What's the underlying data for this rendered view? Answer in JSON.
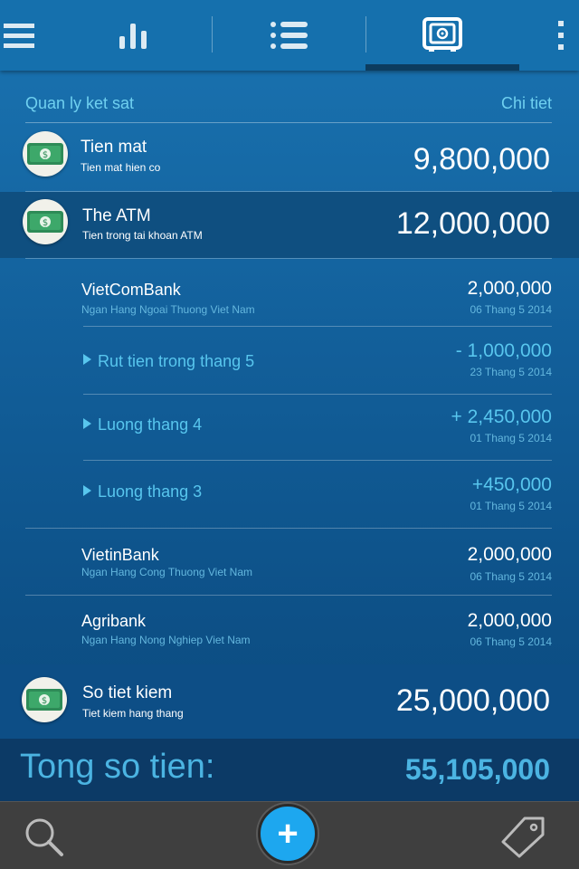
{
  "toolbar": {
    "icons": [
      "menu-icon",
      "chart-icon",
      "list-icon",
      "safe-icon",
      "more-icon"
    ],
    "active": "safe-icon"
  },
  "header": {
    "title": "Quan ly ket sat",
    "detail_link": "Chi tiet"
  },
  "accounts": {
    "cash": {
      "name": "Tien mat",
      "desc": "Tien mat hien co",
      "amount": "9,800,000"
    },
    "atm": {
      "name": "The ATM",
      "desc": "Tien trong tai khoan ATM",
      "amount": "12,000,000"
    },
    "savings": {
      "name": "So tiet kiem",
      "desc": "Tiet kiem hang thang",
      "amount": "25,000,000"
    }
  },
  "banks": [
    {
      "name": "VietComBank",
      "desc": "Ngan Hang Ngoai Thuong Viet Nam",
      "amount": "2,000,000",
      "date": "06 Thang 5 2014"
    },
    {
      "name": "VietinBank",
      "desc": "Ngan Hang Cong Thuong Viet Nam",
      "amount": "2,000,000",
      "date": "06 Thang 5 2014"
    },
    {
      "name": "Agribank",
      "desc": "Ngan Hang Nong Nghiep Viet Nam",
      "amount": "2,000,000",
      "date": "06 Thang 5 2014"
    }
  ],
  "transactions": [
    {
      "label": "Rut tien trong thang 5",
      "amount": "- 1,000,000",
      "date": "23 Thang 5 2014"
    },
    {
      "label": "Luong thang 4",
      "amount": "+ 2,450,000",
      "date": "01 Thang 5 2014"
    },
    {
      "label": "Luong thang 3",
      "amount": "+450,000",
      "date": "01 Thang 5 2014"
    }
  ],
  "total": {
    "label": "Tong so tien:",
    "value": "55,105,000"
  },
  "bottom": {
    "icons": [
      "search-icon",
      "add-icon",
      "tag-icon"
    ],
    "add_label": "+"
  },
  "colors": {
    "accent": "#1da7ef",
    "highlight_text": "#58c6ee",
    "background": "#125f9a"
  }
}
